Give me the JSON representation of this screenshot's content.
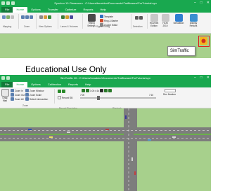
{
  "synchro": {
    "title": "Synchro 10 Classroom - C:\\Users\\bmakino\\Documents\\Trafficware\\ForTutorial.syn",
    "tabs": [
      "File",
      "Home",
      "Options",
      "Transfer",
      "Optimize",
      "Reports",
      "Help"
    ],
    "active_tab": "Home",
    "groups": [
      "Mapping",
      "Zoom",
      "View Options",
      "Lanes & Volumes",
      "Signal Timing",
      "Detection"
    ],
    "buttons": {
      "timing_settings": "Timing Settings",
      "template": "Template",
      "ring_barrier": "Ring & Barrier",
      "cluster_editor": "Cluster Editor",
      "hcm_6th": "HCM 6th Edition",
      "hcm_2010": "HCM 2010",
      "simulation": "Simulation",
      "display_results": "Display Results"
    },
    "popup_label": "SimTraffic"
  },
  "watermark": "Educational Use Only",
  "simtraffic": {
    "title": "SimTraffic 10 - C:\\Users\\bmakino\\Documents\\Trafficware\\ForTutorial.syn",
    "tabs": [
      "File",
      "Home",
      "Options",
      "Calibration",
      "Reports",
      "Help"
    ],
    "active_tab": "Home",
    "buttons": {
      "drag_map": "Drag Map",
      "zoom_in": "Zoom In",
      "zoom_out": "Zoom Out",
      "zoom_all": "Zoom All",
      "zoom_window": "Zoom Window",
      "zoom_scale": "Zoom Scale",
      "select_intersection": "Select Intersection",
      "record_sb": "Record SB",
      "run_number": "Run Number"
    },
    "speed": "1:00:4:1k",
    "time_left": "7:00",
    "time_right": "7:10",
    "sim_label": "7:00",
    "groups": [
      "Zoom",
      "Record Simulation",
      "Playback"
    ]
  },
  "colors": {
    "titlebar_green": "#19a84f",
    "map_green": "#a7d08c",
    "road_gray": "#7d7d7d",
    "highlight_red": "#e02020"
  }
}
